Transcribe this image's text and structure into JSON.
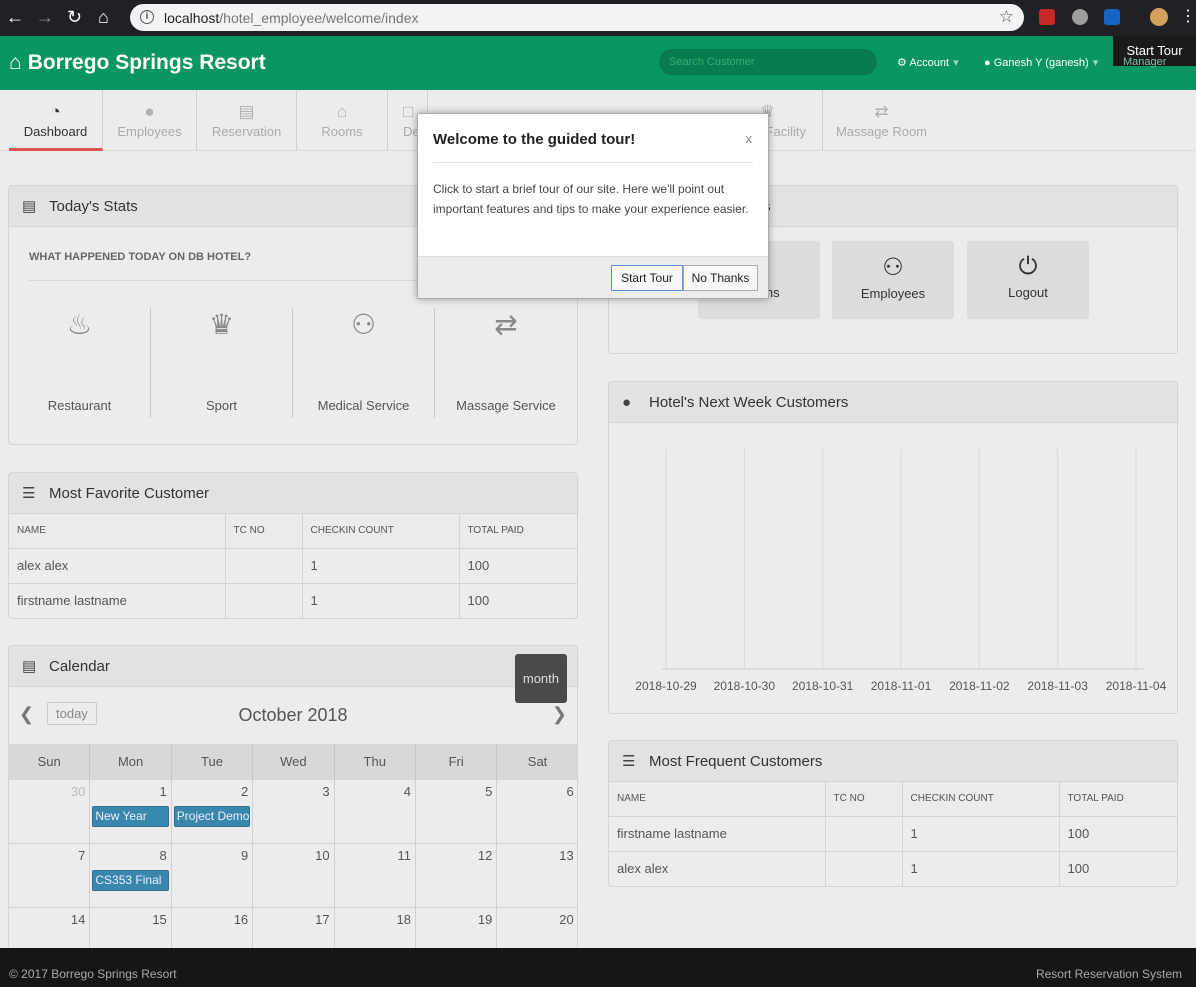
{
  "browser": {
    "url_host": "localhost",
    "url_path": "/hotel_employee/welcome/index"
  },
  "header": {
    "brand": "Borrego Springs Resort",
    "search_placeholder": "Search Customer",
    "account": "Account",
    "user": "Ganesh Y (ganesh)",
    "start_tour": "Start Tour",
    "role": "Manager"
  },
  "tabs": [
    {
      "label": "Dashboard"
    },
    {
      "label": "Employees"
    },
    {
      "label": "Reservation"
    },
    {
      "label": "Rooms"
    },
    {
      "label": "De"
    },
    {
      "label": "Facility"
    },
    {
      "label": "Massage Room"
    }
  ],
  "today_stats": {
    "title": "Today's Stats",
    "subtitle": "WHAT HAPPENED TODAY ON DB HOTEL?",
    "items": [
      {
        "label": "Restaurant",
        "icon": "fire-icon"
      },
      {
        "label": "Sport",
        "icon": "trophy-icon"
      },
      {
        "label": "Medical Service",
        "icon": "user-md-icon"
      },
      {
        "label": "Massage Service",
        "icon": "retweet-icon"
      }
    ]
  },
  "shortcuts": {
    "title_fragment": "ts",
    "items": [
      {
        "label": "Rooms"
      },
      {
        "label": "Employees"
      },
      {
        "label": "Logout"
      }
    ]
  },
  "fav_customer": {
    "title": "Most Favorite Customer",
    "headers": [
      "NAME",
      "TC NO",
      "CHECKIN COUNT",
      "TOTAL PAID"
    ],
    "rows": [
      [
        "alex alex",
        "",
        "1",
        "100"
      ],
      [
        "firstname lastname",
        "",
        "1",
        "100"
      ]
    ]
  },
  "next_week": {
    "title": "Hotel's Next Week Customers"
  },
  "chart_data": {
    "type": "line",
    "x": [
      "2018-10-29",
      "2018-10-30",
      "2018-10-31",
      "2018-11-01",
      "2018-11-02",
      "2018-11-03",
      "2018-11-04"
    ],
    "series": []
  },
  "freq_customers": {
    "title": "Most Frequent Customers",
    "headers": [
      "NAME",
      "TC NO",
      "CHECKIN COUNT",
      "TOTAL PAID"
    ],
    "rows": [
      [
        "firstname lastname",
        "",
        "1",
        "100"
      ],
      [
        "alex alex",
        "",
        "1",
        "100"
      ]
    ]
  },
  "calendar": {
    "title": "Calendar",
    "month_btn": "month",
    "today_btn": "today",
    "month_title": "October 2018",
    "weekdays": [
      "Sun",
      "Mon",
      "Tue",
      "Wed",
      "Thu",
      "Fri",
      "Sat"
    ],
    "weeks": [
      [
        "30",
        "1",
        "2",
        "3",
        "4",
        "5",
        "6"
      ],
      [
        "7",
        "8",
        "9",
        "10",
        "11",
        "12",
        "13"
      ],
      [
        "14",
        "15",
        "16",
        "17",
        "18",
        "19",
        "20"
      ]
    ],
    "events": [
      {
        "label": "New Year",
        "week": 0,
        "day": 1
      },
      {
        "label": "Project Demo",
        "week": 0,
        "day": 2
      },
      {
        "label": "CS353 Final",
        "week": 1,
        "day": 1
      }
    ]
  },
  "modal": {
    "title": "Welcome to the guided tour!",
    "close": "x",
    "body": "Click to start a brief tour of our site. Here we'll point out important features and tips to make your experience easier.",
    "start": "Start Tour",
    "no": "No Thanks"
  },
  "footer": {
    "left": "© 2017 Borrego Springs Resort",
    "right": "Resort Reservation System"
  }
}
